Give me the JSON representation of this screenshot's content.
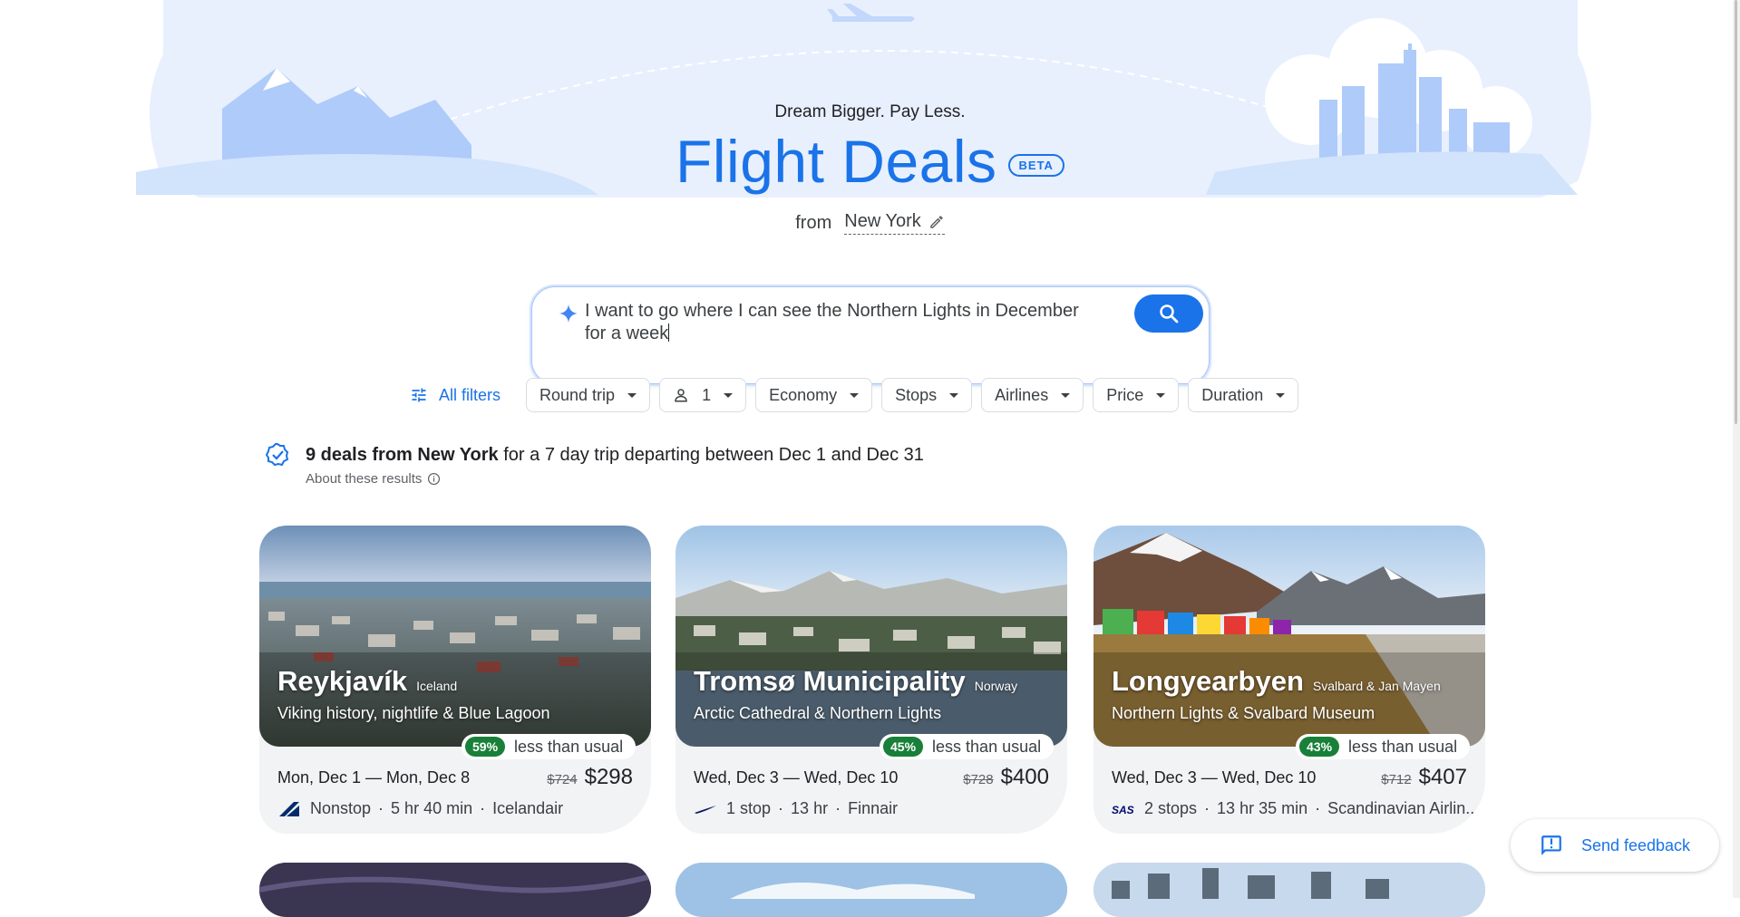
{
  "hero": {
    "tagline": "Dream Bigger. Pay Less.",
    "title": "Flight Deals",
    "badge": "BETA",
    "from_label": "from",
    "origin": "New York"
  },
  "search": {
    "query_line1": "I want to go where I can see the Northern Lights in December",
    "query_line2": "for a week",
    "button_icon": "search-icon"
  },
  "filters": {
    "all_filters": "All filters",
    "chips": [
      "Round trip",
      "1",
      "Economy",
      "Stops",
      "Airlines",
      "Price",
      "Duration"
    ]
  },
  "summary": {
    "bold": "9 deals from New York",
    "rest": " for a 7 day trip departing between Dec 1 and Dec 31",
    "about": "About these results"
  },
  "deals": [
    {
      "city": "Reykjavík",
      "country": "Iceland",
      "description": "Viking history, nightlife & Blue Lagoon",
      "percent": "59%",
      "less_label": "less than usual",
      "dates": "Mon, Dec 1 — Mon, Dec 8",
      "old_price": "$724",
      "price": "$298",
      "stops": "Nonstop",
      "duration": "5 hr 40 min",
      "airline": "Icelandair"
    },
    {
      "city": "Tromsø Municipality",
      "country": "Norway",
      "description": "Arctic Cathedral & Northern Lights",
      "percent": "45%",
      "less_label": "less than usual",
      "dates": "Wed, Dec 3 — Wed, Dec 10",
      "old_price": "$728",
      "price": "$400",
      "stops": "1 stop",
      "duration": "13 hr",
      "airline": "Finnair"
    },
    {
      "city": "Longyearbyen",
      "country": "Svalbard & Jan Mayen",
      "description": "Northern Lights & Svalbard Museum",
      "percent": "43%",
      "less_label": "less than usual",
      "dates": "Wed, Dec 3 — Wed, Dec 10",
      "old_price": "$712",
      "price": "$407",
      "stops": "2 stops",
      "duration": "13 hr 35 min",
      "airline": "Scandinavian Airlin...",
      "airline_logo_text": "SAS"
    }
  ],
  "feedback": {
    "label": "Send feedback"
  },
  "colors": {
    "accent": "#1a73e8",
    "deal_green": "#188038",
    "hero_bg": "#e8f0fe"
  }
}
